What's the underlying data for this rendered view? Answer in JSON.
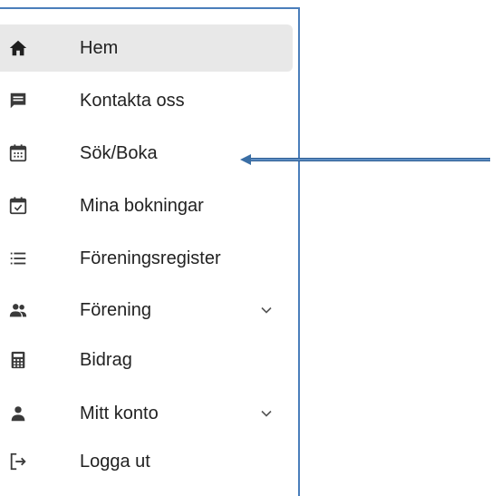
{
  "menu": {
    "items": [
      {
        "label": "Hem",
        "icon": "home-icon",
        "active": true
      },
      {
        "label": "Kontakta oss",
        "icon": "message-icon"
      },
      {
        "label": "Sök/Boka",
        "icon": "calendar-icon"
      },
      {
        "label": "Mina bokningar",
        "icon": "calendar-check-icon"
      },
      {
        "label": "Föreningsregister",
        "icon": "list-icon"
      },
      {
        "label": "Förening",
        "icon": "group-icon",
        "expandable": true
      },
      {
        "label": "Bidrag",
        "icon": "calculator-icon"
      },
      {
        "label": "Mitt konto",
        "icon": "person-icon",
        "expandable": true
      },
      {
        "label": "Logga ut",
        "icon": "logout-icon"
      }
    ]
  },
  "colors": {
    "panel_border": "#4a7ebb",
    "active_background": "#e8e8e8",
    "icon": "#3a3a3a",
    "arrow": "#4a7ebb"
  }
}
